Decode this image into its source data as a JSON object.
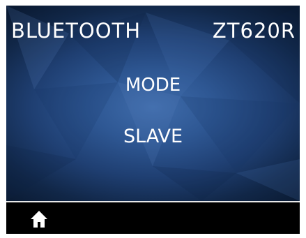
{
  "header": {
    "title": "BLUETOOTH",
    "model": "ZT620R"
  },
  "setting": {
    "name": "MODE",
    "value": "SLAVE"
  },
  "footer": {
    "home_icon": "home-icon"
  },
  "colors": {
    "screen_background": "#000000",
    "panel_gradient_center": "#3f6cab",
    "panel_gradient_edge": "#0a1a32",
    "text": "#ffffff",
    "divider": "#e8e8e8"
  }
}
